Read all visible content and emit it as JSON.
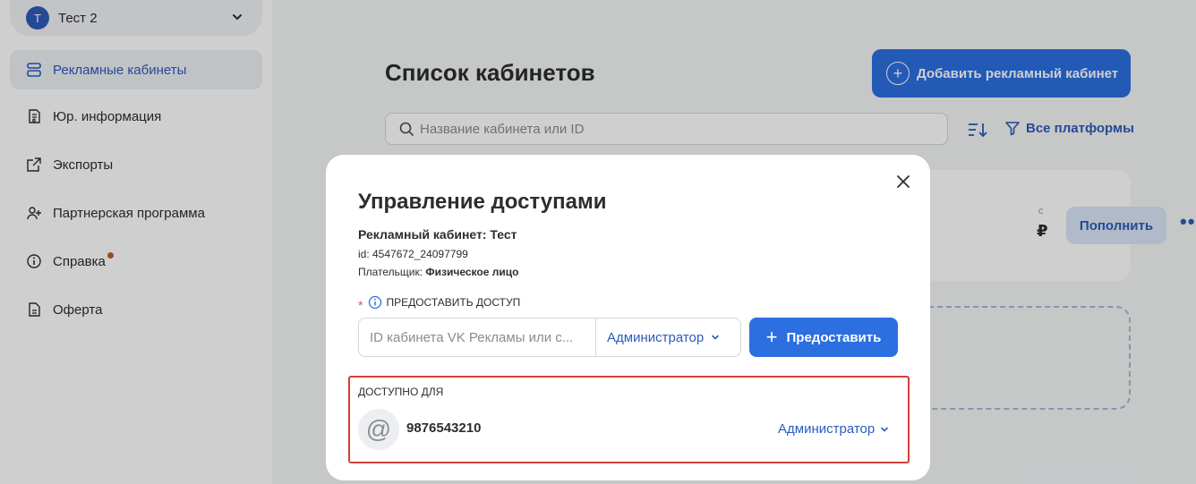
{
  "account": {
    "avatar_letter": "Т",
    "name": "Тест 2"
  },
  "sidebar": {
    "items": [
      {
        "label": "Рекламные кабинеты",
        "icon": "cabinets-icon",
        "active": true
      },
      {
        "label": "Юр. информация",
        "icon": "legal-doc-icon"
      },
      {
        "label": "Экспорты",
        "icon": "export-icon"
      },
      {
        "label": "Партнерская программа",
        "icon": "partner-icon"
      },
      {
        "label": "Справка",
        "icon": "help-icon",
        "badge": true
      },
      {
        "label": "Оферта",
        "icon": "offer-doc-icon"
      }
    ]
  },
  "main": {
    "title": "Список кабинетов",
    "add_button": "Добавить рекламный кабинет",
    "search_placeholder": "Название кабинета или ID",
    "filter_label": "Все платформы",
    "card": {
      "fragment_top": "с",
      "fragment_amount": "₽",
      "topup_label": "Пополнить",
      "more_label": "•••"
    }
  },
  "modal": {
    "title": "Управление доступами",
    "cabinet_prefix": "Рекламный кабинет: ",
    "cabinet_name": "Тест",
    "id_line": "id: 4547672_24097799",
    "payer_prefix": "Плательщик: ",
    "payer_value": "Физическое лицо",
    "grant_label": "ПРЕДОСТАВИТЬ ДОСТУП",
    "input_placeholder": "ID кабинета VK Рекламы или с...",
    "role_selected": "Администратор",
    "grant_button": "Предоставить",
    "access_label": "ДОСТУПНО ДЛЯ",
    "access_list": [
      {
        "user_id": "9876543210",
        "role": "Администратор"
      }
    ]
  },
  "colors": {
    "accent": "#2c6fe0",
    "link": "#2d5bba",
    "highlight_border": "#d43f3a"
  }
}
